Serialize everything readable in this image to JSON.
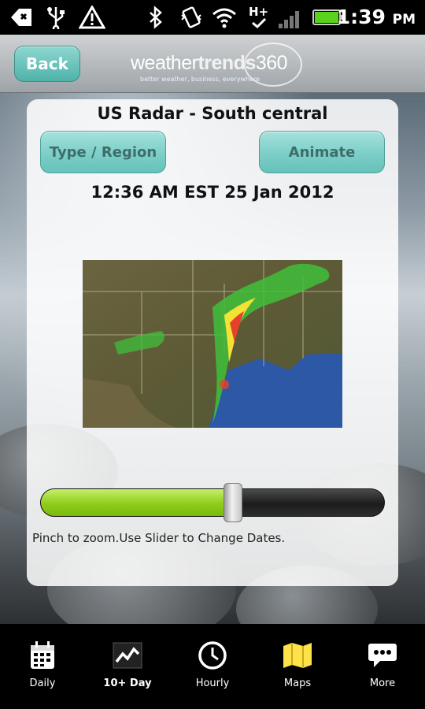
{
  "status_bar": {
    "time": "1:39",
    "ampm": "PM",
    "network_type": "H+",
    "battery_level": 1.0,
    "icons": [
      "notification-icon",
      "usb-icon",
      "warning-icon",
      "bluetooth-icon",
      "vibrate-icon",
      "wifi-icon",
      "signal-icon",
      "battery-icon"
    ]
  },
  "header": {
    "back_label": "Back",
    "logo_part1": "weather",
    "logo_part2": "trends",
    "logo_part3": "360",
    "logo_tagline": "better weather, business, everywhere"
  },
  "panel": {
    "title": "US Radar - South central",
    "type_region_label": "Type / Region",
    "animate_label": "Animate",
    "timestamp": "12:36 AM EST 25 Jan 2012",
    "slider_value": 0.56,
    "hint": "Pinch to zoom.Use Slider to Change Dates."
  },
  "nav": {
    "items": [
      {
        "label": "Daily",
        "icon": "calendar-icon"
      },
      {
        "label": "10+ Day",
        "icon": "trend-chart-icon"
      },
      {
        "label": "Hourly",
        "icon": "clock-icon"
      },
      {
        "label": "Maps",
        "icon": "map-icon"
      },
      {
        "label": "More",
        "icon": "chat-more-icon"
      }
    ]
  },
  "colors": {
    "accent_teal": "#65c2ba",
    "slider_green": "#8fcd1a",
    "maps_yellow": "#ffe14a"
  }
}
